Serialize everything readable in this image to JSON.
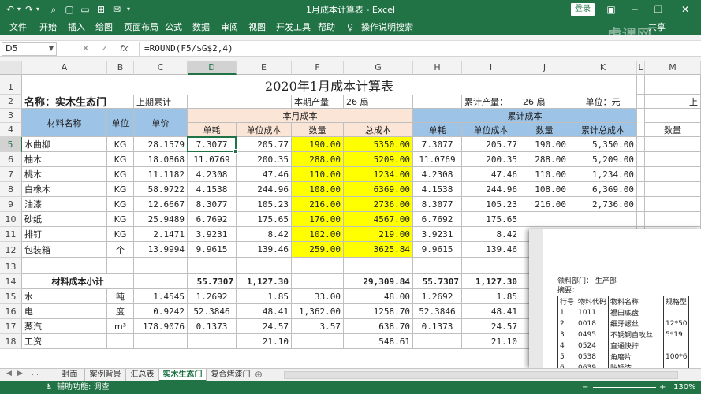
{
  "titlebar": {
    "title": "1月成本计算表 - Excel",
    "login": "登录",
    "undo_icon": "↶",
    "redo_icon": "↷",
    "qa_icons": [
      "↶",
      "▾",
      "↷",
      "▾",
      "⌕",
      "▢",
      "▭",
      "⊞",
      "✉",
      "▾"
    ],
    "window_icons": [
      "▣",
      "─",
      "❐",
      "✕"
    ]
  },
  "ribbon": {
    "tabs": [
      "文件",
      "开始",
      "插入",
      "绘图",
      "页面布局",
      "公式",
      "数据",
      "审阅",
      "视图",
      "开发工具",
      "帮助"
    ],
    "tell_me_icon": "♀",
    "tell_me": "操作说明搜索",
    "share": "共享",
    "watermark": "虎课网"
  },
  "formula_bar": {
    "name_box": "D5",
    "cancel": "✕",
    "enter": "✓",
    "fx": "fx",
    "formula": "=ROUND(F5/$G$2,4)"
  },
  "columns": [
    "A",
    "B",
    "C",
    "D",
    "E",
    "F",
    "G",
    "H",
    "I",
    "J",
    "K",
    "L",
    "M"
  ],
  "rows": [
    "1",
    "2",
    "3",
    "4",
    "5",
    "6",
    "7",
    "8",
    "9",
    "10",
    "11",
    "12",
    "13",
    "14",
    "15",
    "16",
    "17",
    "18"
  ],
  "sheet": {
    "title": "2020年1月成本计算表",
    "r2": {
      "name": "名称：实木生态门",
      "prev_total": "上期累计",
      "cur_output": "本期产量",
      "cur_value": "26 扇",
      "cum_output": "累计产量：",
      "cum_value": "26 扇",
      "unit": "单位：元",
      "m_cut": "上"
    },
    "hdr": {
      "material": "材料名称",
      "unit": "单位",
      "price": "单价",
      "month_cost": "本月成本",
      "cum_cost": "累计成本",
      "consumption": "单耗",
      "unit_cost": "单位成本",
      "qty": "数量",
      "total_cost": "总成本",
      "cum_total_cost": "累计总成本",
      "m_qty": "数量"
    },
    "data_rows": [
      {
        "a": "水曲柳",
        "b": "KG",
        "c": "28.1579",
        "d": "7.3077",
        "e": "205.77",
        "f": "190.00",
        "g": "5350.00",
        "h": "7.3077",
        "i": "205.77",
        "j": "190.00",
        "k": "5,350.00"
      },
      {
        "a": "柚木",
        "b": "KG",
        "c": "18.0868",
        "d": "11.0769",
        "e": "200.35",
        "f": "288.00",
        "g": "5209.00",
        "h": "11.0769",
        "i": "200.35",
        "j": "288.00",
        "k": "5,209.00"
      },
      {
        "a": "桃木",
        "b": "KG",
        "c": "11.1182",
        "d": "4.2308",
        "e": "47.46",
        "f": "110.00",
        "g": "1234.00",
        "h": "4.2308",
        "i": "47.46",
        "j": "110.00",
        "k": "1,234.00"
      },
      {
        "a": "白橡木",
        "b": "KG",
        "c": "58.9722",
        "d": "4.1538",
        "e": "244.96",
        "f": "108.00",
        "g": "6369.00",
        "h": "4.1538",
        "i": "244.96",
        "j": "108.00",
        "k": "6,369.00"
      },
      {
        "a": "油漆",
        "b": "KG",
        "c": "12.6667",
        "d": "8.3077",
        "e": "105.23",
        "f": "216.00",
        "g": "2736.00",
        "h": "8.3077",
        "i": "105.23",
        "j": "216.00",
        "k": "2,736.00"
      },
      {
        "a": "砂纸",
        "b": "KG",
        "c": "25.9489",
        "d": "6.7692",
        "e": "175.65",
        "f": "176.00",
        "g": "4567.00",
        "h": "6.7692",
        "i": "175.65",
        "j": "",
        "k": ""
      },
      {
        "a": "排钉",
        "b": "KG",
        "c": "2.1471",
        "d": "3.9231",
        "e": "8.42",
        "f": "102.00",
        "g": "219.00",
        "h": "3.9231",
        "i": "8.42",
        "j": "",
        "k": ""
      },
      {
        "a": "包装箱",
        "b": "个",
        "c": "13.9994",
        "d": "9.9615",
        "e": "139.46",
        "f": "259.00",
        "g": "3625.84",
        "h": "9.9615",
        "i": "139.46",
        "j": "",
        "k": ""
      }
    ],
    "subtotal": {
      "a": "材料成本小计",
      "d": "55.7307",
      "e": "1,127.30",
      "g": "29,309.84",
      "h": "55.7307",
      "i": "1,127.30"
    },
    "other_rows": [
      {
        "a": "水",
        "b": "吨",
        "c": "1.4545",
        "d": "1.2692",
        "e": "1.85",
        "f": "33.00",
        "g": "48.00",
        "h": "1.2692",
        "i": "1.85"
      },
      {
        "a": "电",
        "b": "度",
        "c": "0.9242",
        "d": "52.3846",
        "e": "48.41",
        "f": "1,362.00",
        "g": "1258.70",
        "h": "52.3846",
        "i": "48.41",
        "j": "1,36"
      },
      {
        "a": "蒸汽",
        "b": "m³",
        "c": "178.9076",
        "d": "0.1373",
        "e": "24.57",
        "f": "3.57",
        "g": "638.70",
        "h": "0.1373",
        "i": "24.57"
      },
      {
        "a": "工资",
        "b": "",
        "c": "",
        "d": "",
        "e": "21.10",
        "f": "",
        "g": "548.61",
        "h": "",
        "i": "21.10"
      }
    ]
  },
  "overlay": {
    "dept": "领料部门： 生产部",
    "summary": "摘要：",
    "headers": [
      "行号",
      "物料代码",
      "物料名称",
      "规格型"
    ],
    "rows": [
      [
        "1",
        "1011",
        "福田底盘",
        ""
      ],
      [
        "2",
        "0018",
        "细牙螺丝",
        "12*50"
      ],
      [
        "3",
        "0495",
        "不锈钢自攻丝",
        "5*19"
      ],
      [
        "4",
        "0524",
        "直通快拧",
        ""
      ],
      [
        "5",
        "0538",
        "角磨片",
        "100*6"
      ],
      [
        "6",
        "0639",
        "防锈漆",
        ""
      ]
    ]
  },
  "sheet_tabs": [
    "封面",
    "案例背景",
    "汇总表",
    "实木生态门",
    "复合烤漆门"
  ],
  "active_sheet": "实木生态门",
  "status": {
    "accessibility": "辅助功能: 调查",
    "zoom": "130%",
    "zoom_minus": "−",
    "zoom_plus": "+"
  }
}
